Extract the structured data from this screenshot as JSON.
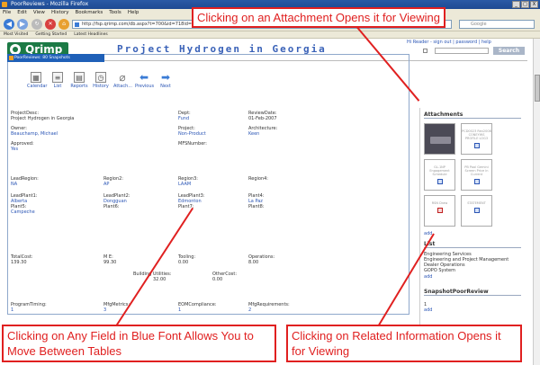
{
  "window": {
    "title": "PoorReviews - Mozilla Firefox",
    "controls": [
      "_",
      "□",
      "X"
    ]
  },
  "menubar": [
    "File",
    "Edit",
    "View",
    "History",
    "Bookmarks",
    "Tools",
    "Help"
  ],
  "navbar": {
    "url": "http://fsp.qrimp.com/db.aspx?t=700&id=718id=1",
    "search_placeholder": "Google",
    "back_icon": "arrow-left-icon",
    "forward_icon": "arrow-right-icon"
  },
  "bookmarks": [
    "Most Visited",
    "Getting Started",
    "Latest Headlines"
  ],
  "header": {
    "logo_text": "Qrimp",
    "app_title": "Project Hydrogen in Georgia",
    "user_links": "Hi Reader - sign out | password | help",
    "search_button": "Search"
  },
  "panel_tab": "PoorReviews: 80 Snapshots",
  "toolbar": {
    "calendar": "Calendar",
    "list": "List",
    "reports": "Reports",
    "history": "History",
    "attach": "Attach...",
    "previous": "Previous",
    "next": "Next"
  },
  "fields": {
    "project_desc": {
      "label": "ProjectDesc:",
      "value": "Project Hydrogen in Georgia"
    },
    "dept": {
      "label": "Dept:",
      "value": "Fund"
    },
    "review_date": {
      "label": "ReviewDate:",
      "value": "01-Feb-2007"
    },
    "owner": {
      "label": "Owner:",
      "value": "Beauchamp, Michael"
    },
    "project": {
      "label": "Project:",
      "value": "Non-Product"
    },
    "architecture": {
      "label": "Architecture:",
      "value": "Keen"
    },
    "approved": {
      "label": "Approved:",
      "value": "Yes"
    },
    "mfsnumber": {
      "label": "MFSNumber:",
      "value": ""
    },
    "lead_region": {
      "label": "LeadRegion:",
      "value": "NA"
    },
    "region2": {
      "label": "Region2:",
      "value": "AP"
    },
    "region3": {
      "label": "Region3:",
      "value": "LAAM"
    },
    "region4": {
      "label": "Region4:",
      "value": ""
    },
    "lead_plant1": {
      "label": "LeadPlant1:",
      "value": "Alberta"
    },
    "lead_plant2": {
      "label": "LeadPlant2:",
      "value": "Dongguan"
    },
    "lead_plant3": {
      "label": "LeadPlant3:",
      "value": "Edmonton"
    },
    "plant4": {
      "label": "Plant4:",
      "value": "La Paz"
    },
    "plant5": {
      "label": "Plant5:",
      "value": "Campeche"
    },
    "plant6": {
      "label": "Plant6:",
      "value": ""
    },
    "plant7": {
      "label": "Plant7:",
      "value": ""
    },
    "plant8": {
      "label": "Plant8:",
      "value": ""
    },
    "total_cost": {
      "label": "TotalCost:",
      "value": "139.30"
    },
    "m_e": {
      "label": "M E:",
      "value": "99.30"
    },
    "tooling": {
      "label": "Tooling:",
      "value": "0.00"
    },
    "operations": {
      "label": "Operations:",
      "value": "8.00"
    },
    "building_utilities": {
      "label": "Building Utilities:",
      "value": "32.00"
    },
    "other_cost": {
      "label": "OtherCost:",
      "value": "0.00"
    },
    "program_timing": {
      "label": "ProgramTiming:",
      "value": "1"
    },
    "mfg_metrics": {
      "label": "MfgMetrics:",
      "value": "3"
    },
    "eom_compliance": {
      "label": "EOMCompliance:",
      "value": "1"
    },
    "mfg_requirements": {
      "label": "MfgRequirements:",
      "value": "2"
    }
  },
  "right": {
    "attachments_title": "Attachments",
    "attachments": [
      {
        "label": "",
        "kind": "photo"
      },
      {
        "label": "PCD0023 Rev2008 CONEYWS PROFILE LOG3",
        "kind": "doc"
      },
      {
        "label": "GL-1NP Engagement Schedule",
        "kind": "doc"
      },
      {
        "label": "PB Pool Gemini Screen Price in Current",
        "kind": "doc"
      },
      {
        "label": "RSN Draw",
        "kind": "pdf"
      },
      {
        "label": "STATEMENT",
        "kind": "doc"
      }
    ],
    "add1": "add",
    "list_title": "List",
    "list_items": [
      "Engineering Services",
      "Engineering and Project Management",
      "Dealer Operations",
      "GOPO System"
    ],
    "add2": "add",
    "snapshot_title": "SnapshotPoorReview",
    "snapshot_count": "1",
    "add3": "add"
  },
  "callouts": {
    "top": "Clicking on an Attachment Opens it for Viewing",
    "bottom_left": "Clicking on Any Field in Blue Font Allows You to Move Between Tables",
    "bottom_right": "Clicking on Related Information Opens it for Viewing"
  },
  "colors": {
    "accent": "#2a55b5",
    "callout": "#e02020",
    "logo": "#1c7a45",
    "tab": "#1f60b8"
  }
}
